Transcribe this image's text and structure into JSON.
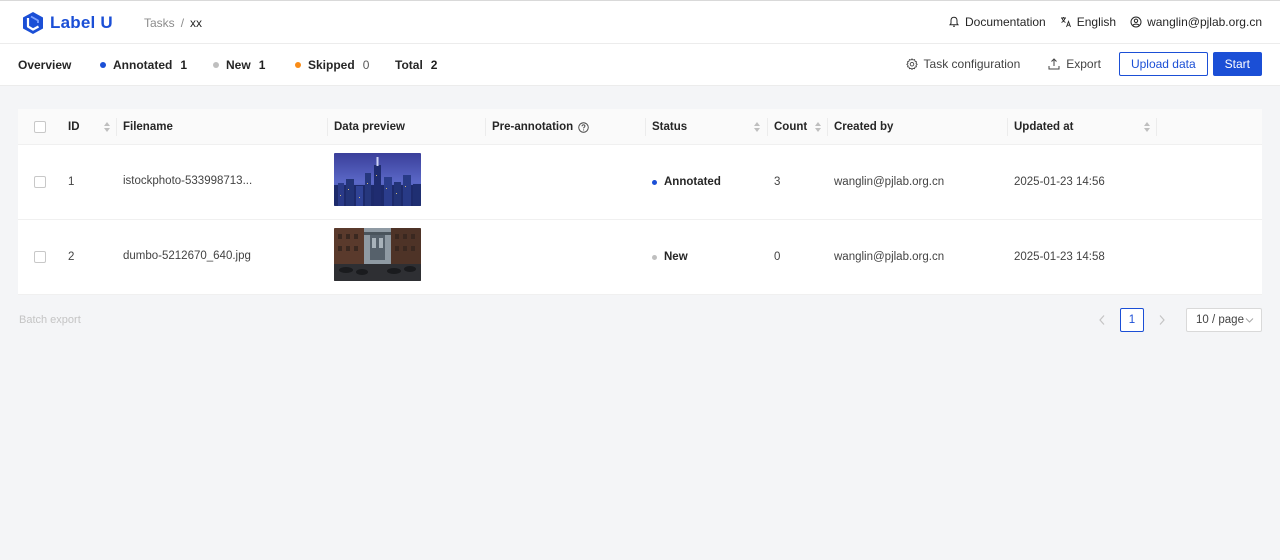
{
  "app": {
    "name": "Label U",
    "brand_color": "#1b4fd6"
  },
  "breadcrumb": {
    "root": "Tasks",
    "separator": "/",
    "current": "xx"
  },
  "topbar": {
    "documentation": "Documentation",
    "language": "English",
    "user": "wanglin@pjlab.org.cn",
    "icons": [
      "bell-icon",
      "translate-icon",
      "user-icon"
    ]
  },
  "stats": {
    "overview": "Overview",
    "annotated_label": "Annotated",
    "annotated_count": "1",
    "annotated_color": "#1b4fd6",
    "new_label": "New",
    "new_count": "1",
    "new_color": "#bfbfbf",
    "skipped_label": "Skipped",
    "skipped_count": "0",
    "skipped_color": "#fa8c16",
    "total_label": "Total",
    "total_count": "2"
  },
  "actions": {
    "task_config": "Task configuration",
    "export": "Export",
    "upload": "Upload data",
    "start": "Start"
  },
  "table": {
    "columns": [
      "ID",
      "Filename",
      "Data preview",
      "Pre-annotation",
      "Status",
      "Count",
      "Created by",
      "Updated at"
    ],
    "rows": [
      {
        "id": "1",
        "filename": "istockphoto-533998713...",
        "preview": "city-skyline-thumbnail",
        "status": "Annotated",
        "status_color": "#1b4fd6",
        "count": "3",
        "created_by": "wanglin@pjlab.org.cn",
        "updated_at": "2025-01-23 14:56"
      },
      {
        "id": "2",
        "filename": "dumbo-5212670_640.jpg",
        "preview": "street-bridge-thumbnail",
        "status": "New",
        "status_color": "#bfbfbf",
        "count": "0",
        "created_by": "wanglin@pjlab.org.cn",
        "updated_at": "2025-01-23 14:58"
      }
    ]
  },
  "footer": {
    "batch_export": "Batch export",
    "current_page": "1",
    "page_size": "10 / page"
  }
}
